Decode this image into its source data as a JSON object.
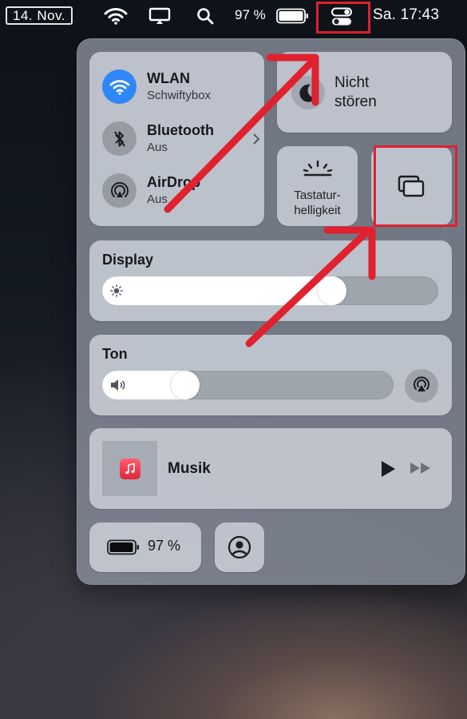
{
  "menubar": {
    "date": "14. Nov.",
    "battery_percent": "97 %",
    "time": "Sa. 17:43",
    "icons": [
      "wifi-icon",
      "display-icon",
      "search-icon",
      "battery-icon",
      "control-center-icon"
    ]
  },
  "control_center": {
    "connectivity": [
      {
        "title": "WLAN",
        "subtitle": "Schwiftybox",
        "icon": "wifi-icon",
        "active": true
      },
      {
        "title": "Bluetooth",
        "subtitle": "Aus",
        "icon": "bluetooth-icon",
        "active": false
      },
      {
        "title": "AirDrop",
        "subtitle": "Aus",
        "icon": "airdrop-icon",
        "active": false
      }
    ],
    "do_not_disturb": {
      "label": "Nicht\nstören",
      "icon": "moon-icon"
    },
    "keyboard_brightness": {
      "label": "Tastatur-\nhelligkeit",
      "icon": "keyboard-brightness-icon"
    },
    "screen_mirroring": {
      "icon": "screen-mirroring-icon"
    },
    "display": {
      "title": "Display",
      "level": 0.7
    },
    "sound": {
      "title": "Ton",
      "level": 0.26
    },
    "music": {
      "title": "Musik",
      "icon": "music-app-icon"
    },
    "battery": {
      "label": "97 %",
      "level": 0.97
    },
    "user": {
      "icon": "user-icon"
    }
  },
  "annotation_color": "#e0212e"
}
